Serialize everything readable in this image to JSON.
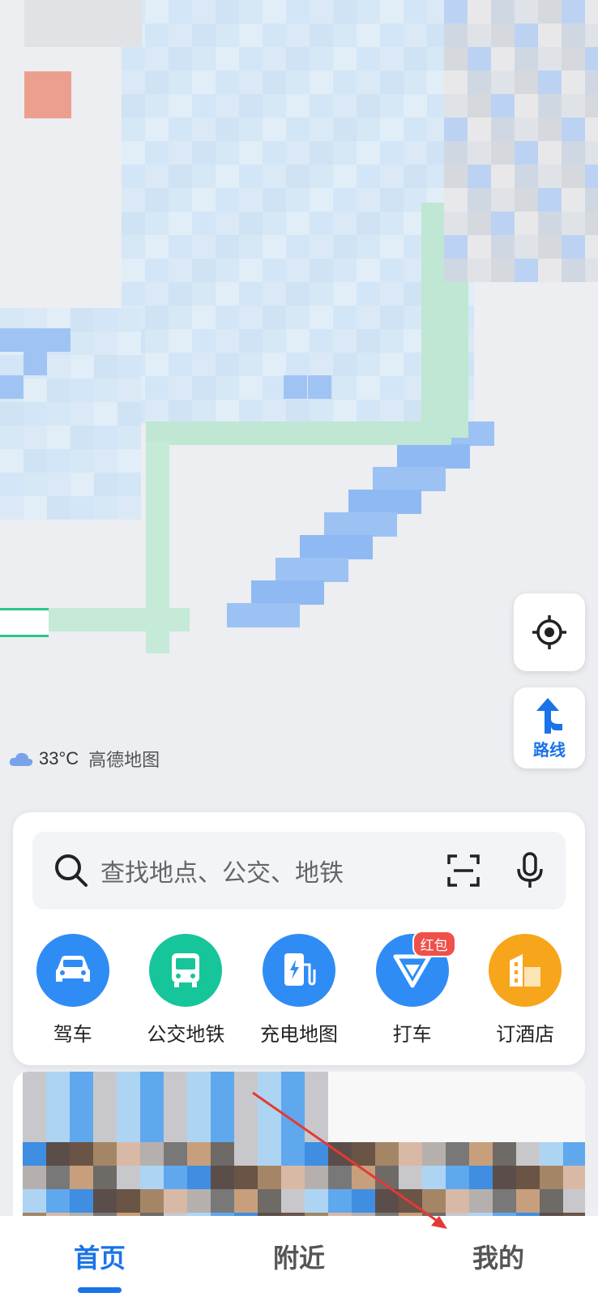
{
  "weather": {
    "temperature": "33°C",
    "brand": "高德地图",
    "icon": "cloud-icon"
  },
  "map_controls": {
    "locate_icon": "locate-icon",
    "route_label": "路线"
  },
  "search": {
    "placeholder": "查找地点、公交、地铁",
    "icons": [
      "search-icon",
      "scan-icon",
      "mic-icon"
    ]
  },
  "services": [
    {
      "label": "驾车",
      "icon": "car-icon",
      "color": "#2f8cf5"
    },
    {
      "label": "公交地铁",
      "icon": "bus-icon",
      "color": "#17c59a"
    },
    {
      "label": "充电地图",
      "icon": "charger-icon",
      "color": "#2f8cf5"
    },
    {
      "label": "打车",
      "icon": "taxi-icon",
      "color": "#2f8cf5",
      "badge": "红包"
    },
    {
      "label": "订酒店",
      "icon": "hotel-icon",
      "color": "#f7a51a"
    }
  ],
  "bottom_nav": {
    "tabs": [
      {
        "label": "首页",
        "active": true
      },
      {
        "label": "附近",
        "active": false
      },
      {
        "label": "我的",
        "active": false
      }
    ]
  },
  "colors": {
    "accent": "#1a73e8",
    "badge": "#f0504a"
  }
}
